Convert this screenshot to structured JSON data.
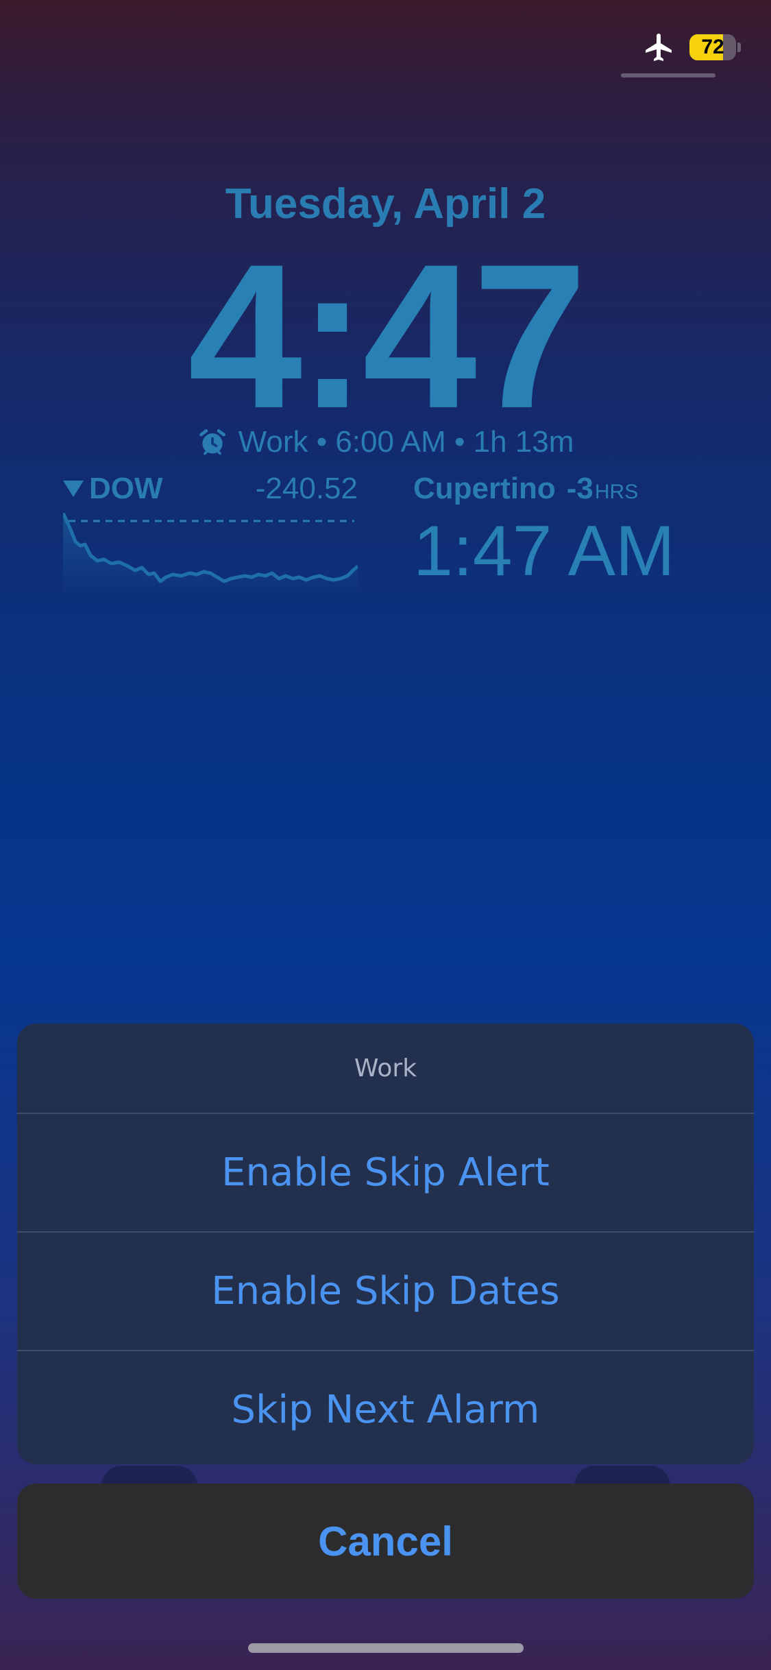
{
  "status_bar": {
    "airplane_icon": "airplane-icon",
    "battery_level": 72,
    "battery_label": "72",
    "battery_color": "#f5d20d"
  },
  "lock_screen": {
    "date": "Tuesday, April 2",
    "time": "4:47",
    "alarm": {
      "icon": "alarm-clock-icon",
      "text": "Work • 6:00 AM • 1h 13m"
    }
  },
  "stock_widget": {
    "symbol": "DOW",
    "direction_icon": "down-triangle-icon",
    "change": "-240.52",
    "chart_color": "#1f70a8"
  },
  "clock_widget": {
    "city": "Cupertino",
    "offset": "-3",
    "offset_unit": "HRS",
    "time": "1:47 AM"
  },
  "action_sheet": {
    "title": "Work",
    "options": [
      {
        "label": "Enable Skip Alert"
      },
      {
        "label": "Enable Skip Dates"
      },
      {
        "label": "Skip Next Alarm"
      }
    ],
    "cancel_label": "Cancel",
    "accent_color": "#4b93f0"
  }
}
